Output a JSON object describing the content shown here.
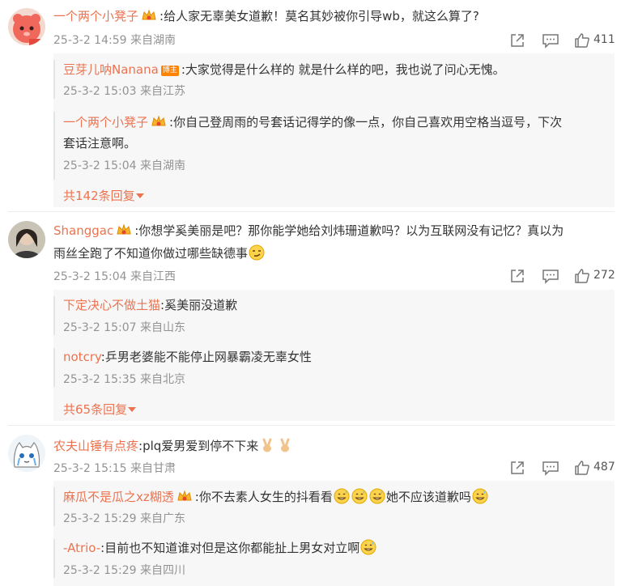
{
  "comments": [
    {
      "user": "一个两个小凳子",
      "text": ":给人家无辜美女道歉！莫名其妙被你引导wb，就这么算了?",
      "meta": "25-3-2 14:59 来自湖南",
      "likes": "411",
      "replies": [
        {
          "user": "豆芽儿呐Nanana",
          "tag": "博主",
          "text": ":大家觉得是什么样的 就是什么样的吧，我也说了问心无愧。",
          "meta": "25-3-2 15:03 来自江苏"
        },
        {
          "user": "一个两个小凳子",
          "text1": ":你自己登周雨的号套话记得学的像一点，你自己喜欢用空格当逗号，下次",
          "text2": "套话注意啊。",
          "meta": "25-3-2 15:04 来自湖南"
        }
      ],
      "more": "共142条回复"
    },
    {
      "user": "Shanggac",
      "text1": ":你想学奚美丽是吧？那你能学她给刘炜珊道歉吗？以为互联网没有记忆？真以为",
      "text2": "雨丝全跑了不知道你做过哪些缺德事",
      "meta": "25-3-2 15:04 来自江西",
      "likes": "272",
      "replies": [
        {
          "user": "下定决心不做土猫",
          "text": ":奚美丽没道歉",
          "meta": "25-3-2 15:07 来自山东"
        },
        {
          "user": "notcry",
          "text": ":乒男老婆能不能停止网暴霸凌无辜女性",
          "meta": "25-3-2 15:35 来自北京"
        }
      ],
      "more": "共65条回复"
    },
    {
      "user": "农夫山锤有点疼",
      "text": ":plq爱男爱到停不下来",
      "meta": "25-3-2 15:15 来自甘肃",
      "likes": "487",
      "replies": [
        {
          "user": "麻瓜不是瓜之xz糊透",
          "text1": ":你不去素人女生的抖看看",
          "text2": "她不应该道歉吗",
          "meta": "25-3-2 15:29 来自广东"
        },
        {
          "user": "-Atrio-",
          "text": ":目前也不知道谁对但是这你都能扯上男女对立啊",
          "meta": "25-3-2 15:29 来自四川"
        }
      ]
    }
  ],
  "icons": {
    "share": "share-icon",
    "comment": "comment-icon",
    "like": "thumbs-up-icon",
    "expand": "caret-down-icon"
  },
  "colors": {
    "username": "#eb7350",
    "meta": "#939393",
    "reply_bg": "#f7f7f7"
  }
}
